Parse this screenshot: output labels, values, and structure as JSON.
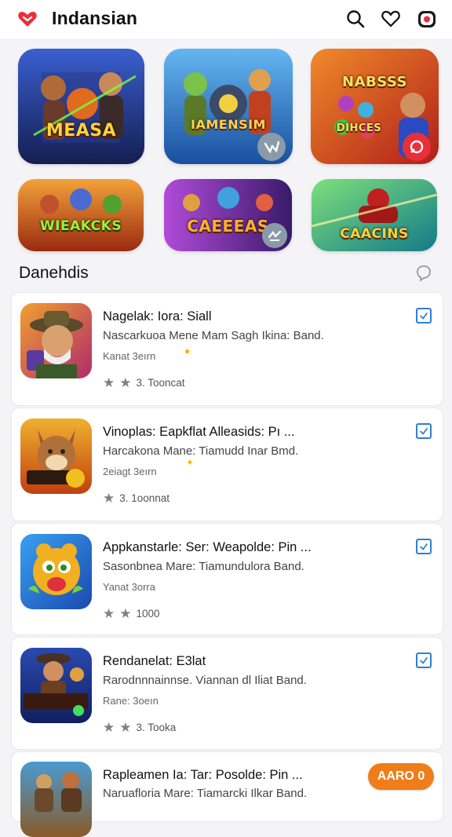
{
  "header": {
    "title": "Indansian",
    "icons": [
      "search-icon",
      "heart-icon",
      "profile-icon"
    ],
    "logo_color": "#e8303a"
  },
  "featured": [
    {
      "title": "MEASA",
      "colors": [
        "#1b2f7a",
        "#3a5fcf"
      ]
    },
    {
      "title": "IAMENSIM",
      "colors": [
        "#1f6fc8",
        "#64b6f0"
      ]
    },
    {
      "title": "NABSSS",
      "subtitle": "DIHCES",
      "colors": [
        "#d0341e",
        "#f08a2a"
      ]
    },
    {
      "title": "WIEAKCKS",
      "colors": [
        "#c6421a",
        "#f3a23a"
      ]
    },
    {
      "title": "CAEEEAS",
      "colors": [
        "#5a1f8a",
        "#b14bd8"
      ]
    },
    {
      "title": "CAACINS",
      "colors": [
        "#1b8f6a",
        "#7de07a"
      ]
    }
  ],
  "section": {
    "title": "Danehdis"
  },
  "items": [
    {
      "name": "Nagelak: Iora: Siall",
      "desc": "Nascarkuoa Mene Mam Sagh Ikina: Band.",
      "sub": "Kanat 3eırn",
      "rating": "3. Tooncat",
      "stars": 2
    },
    {
      "name": "Vinoplas: Eapkflat Alleasids: Pı ...",
      "desc": "Harcakona Mane: Tiamudd Inar Bmd.",
      "sub": "2eiagt 3eırn",
      "rating": "3. 1oonnat",
      "stars": 1
    },
    {
      "name": "Appkanstarle: Ser: Weapolde: Pin ...",
      "desc": "Sasonbnea Mare: Tiamundulora Band.",
      "sub": "Yanat 3orra",
      "rating": "1000",
      "stars": 2
    },
    {
      "name": "Rendanelat: E3lat",
      "desc": "Rarodnnnainnse. Viannan dl Iliat Band.",
      "sub": "Rane: 3oeın",
      "rating": "3. Tooka",
      "stars": 2
    },
    {
      "name": "Rapleamen Ia: Tar: Posolde: Pin ...",
      "desc": "Naruafloria Mare: Tiamarcki Ilkar Band.",
      "action": "AARO 0"
    }
  ]
}
